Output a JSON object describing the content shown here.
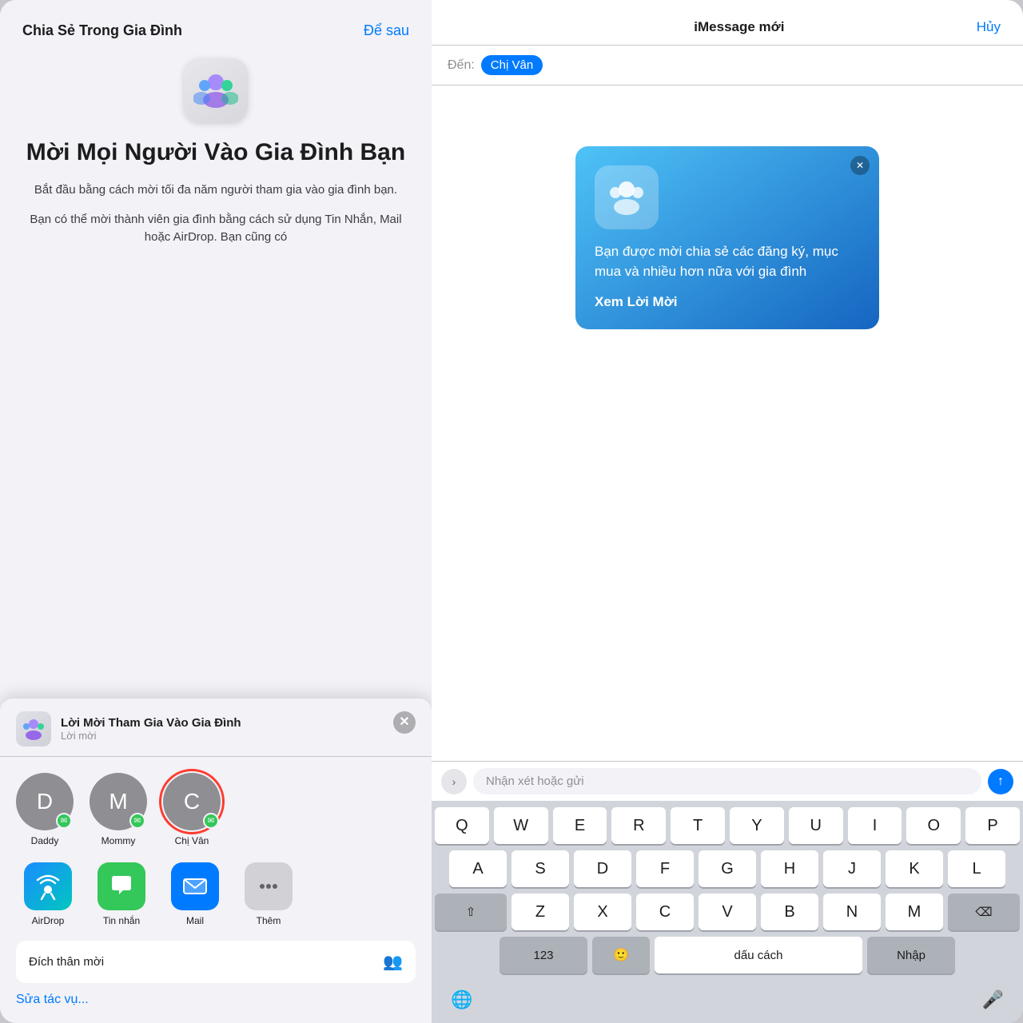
{
  "left": {
    "header_title": "Chia Sẻ Trong Gia Đình",
    "defer_label": "Để sau",
    "invite_heading": "Mời Mọi Người Vào Gia Đình Bạn",
    "invite_desc1": "Bắt đầu bằng cách mời tối đa năm người tham gia vào gia đình bạn.",
    "invite_desc2": "Bạn có thể mời thành viên gia đình bằng cách sử dụng Tin Nhắn, Mail hoặc AirDrop. Bạn cũng có",
    "share_sheet": {
      "title": "Lời Mời Tham Gia Vào Gia Đình",
      "subtitle": "Lời mời",
      "contacts": [
        {
          "initial": "D",
          "name": "Daddy",
          "selected": false
        },
        {
          "initial": "M",
          "name": "Mommy",
          "selected": false
        },
        {
          "initial": "C",
          "name": "Chị Vân",
          "selected": true
        }
      ],
      "apps": [
        {
          "name": "AirDrop"
        },
        {
          "name": "Tin nhắn"
        },
        {
          "name": "Mail"
        },
        {
          "name": "Thêm"
        }
      ],
      "personal_label": "Đích thân mời",
      "edit_tasks_label": "Sửa tác vụ..."
    }
  },
  "right": {
    "header_title": "iMessage mới",
    "cancel_label": "Hủy",
    "to_label": "Đến:",
    "to_chip": "Chị Vân",
    "card": {
      "text": "Bạn được mời chia sẻ các đăng ký, mục mua và nhiều hơn nữa với gia đình",
      "view_label": "Xem Lời Mời"
    },
    "input_placeholder": "Nhận xét hoặc gửi",
    "keyboard": {
      "row1": [
        "Q",
        "W",
        "E",
        "R",
        "T",
        "Y",
        "U",
        "I",
        "O",
        "P"
      ],
      "row2": [
        "A",
        "S",
        "D",
        "F",
        "G",
        "H",
        "J",
        "K",
        "L"
      ],
      "row3": [
        "Z",
        "X",
        "C",
        "V",
        "B",
        "N",
        "M"
      ],
      "bottom": {
        "numbers_label": "123",
        "space_label": "dấu cách",
        "return_label": "Nhập"
      }
    }
  }
}
